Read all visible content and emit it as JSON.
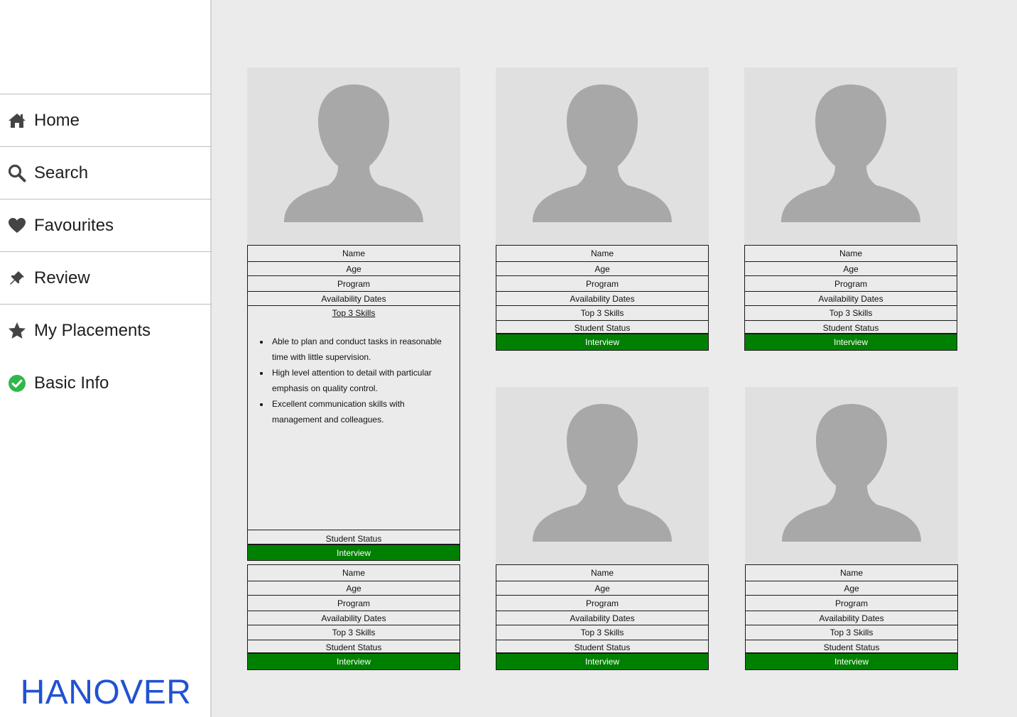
{
  "sidebar": {
    "items": [
      {
        "label": "Home",
        "icon": "home-icon"
      },
      {
        "label": "Search",
        "icon": "search-icon"
      },
      {
        "label": "Favourites",
        "icon": "heart-icon"
      },
      {
        "label": "Review",
        "icon": "pin-icon"
      },
      {
        "label": "My Placements",
        "icon": "star-icon"
      },
      {
        "label": "Basic Info",
        "icon": "check-circle-icon"
      }
    ],
    "brand": "HANOVER"
  },
  "colors": {
    "brand": "#2152d1",
    "interview": "#008000",
    "check": "#2fb84a"
  },
  "card": {
    "name": "Name",
    "age": "Age",
    "program": "Program",
    "availability": "Availability Dates",
    "skills": "Top 3 Skills",
    "status": "Student Status",
    "interview": "Interview"
  },
  "expanded_card": {
    "skills_list": [
      "Able to plan and conduct tasks in reasonable time with little supervision.",
      "High level attention to detail with particular emphasis on quality control.",
      "Excellent communication skills with management and colleagues."
    ]
  }
}
